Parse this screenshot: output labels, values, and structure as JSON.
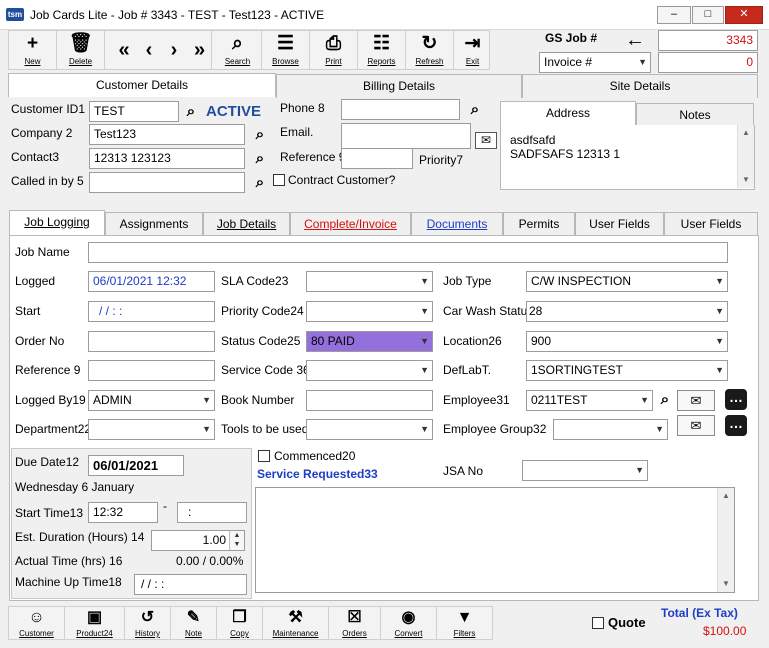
{
  "window": {
    "logo": "tsm",
    "title": "Job Cards Lite - Job # 3343 - TEST - Test123 - ACTIVE"
  },
  "toolbar": {
    "new": "New",
    "delete": "Delete",
    "search": "Search",
    "browse": "Browse",
    "print": "Print",
    "reports": "Reports",
    "refresh": "Refresh",
    "exit": "Exit"
  },
  "gsjob": {
    "label": "GS Job  #",
    "job_number": "3343",
    "mode": "Invoice #",
    "invoice_number": "0"
  },
  "top_tabs": {
    "customer": "Customer Details",
    "billing": "Billing Details",
    "site": "Site Details"
  },
  "customer": {
    "id_label": "Customer ID1",
    "id_value": "TEST",
    "status": "ACTIVE",
    "company_label": "Company 2",
    "company_value": "Test123",
    "contact_label": "Contact3",
    "contact_value": "12313 123123",
    "calledin_label": "Called in by 5",
    "calledin_value": "",
    "phone_label": "Phone 8",
    "email_label": "Email.",
    "ref_label": "Reference 9",
    "priority_label": "Priority7",
    "contract_label": "Contract Customer?"
  },
  "address": {
    "tab_address": "Address",
    "tab_notes": "Notes",
    "line1": "asdfsafd",
    "line2": "SADFSAFS  12313  1"
  },
  "job_tabs": [
    "Job Logging",
    "Assignments",
    "Job Details",
    "Complete/Invoice",
    "Documents",
    "Permits",
    "User Fields",
    "User Fields"
  ],
  "job": {
    "name_label": "Job Name",
    "name_value": "",
    "logged_label": "Logged",
    "logged_value": "06/01/2021 12:32",
    "start_label": "Start",
    "start_value": "/ /      : :",
    "order_label": "Order No",
    "ref_label": "Reference 9",
    "loggedby_label": "Logged By19",
    "loggedby_value": "ADMIN",
    "dept_label": "Department22",
    "sla_label": "SLA Code23",
    "priority_label": "Priority Code24",
    "status_label": "Status Code25",
    "status_value": "80 PAID",
    "service_label": "Service Code 36",
    "book_label": "Book Number",
    "tools_label": "Tools to be used",
    "jobtype_label": "Job Type",
    "jobtype_value": "C/W INSPECTION",
    "carwash_label": "Car Wash Status28",
    "carwash_value": "28",
    "location_label": "Location26",
    "location_value": "900",
    "deflab_label": "DefLabT.",
    "deflab_value": "1SORTINGTEST",
    "employee_label": "Employee31",
    "employee_value": "0211TEST",
    "empgroup_label": "Employee Group32"
  },
  "schedule": {
    "due_label": "Due Date12",
    "due_value": "06/01/2021",
    "day_text": "Wednesday 6 January",
    "starttime_label": "Start Time13",
    "starttime_value": "12:32",
    "dash": "-",
    "endtime_value": ":",
    "duration_label": "Est. Duration (Hours) 14",
    "duration_value": "1.00",
    "actual_label": "Actual Time (hrs) 16",
    "actual_value": "0.00 / 0.00%",
    "machine_label": "Machine Up Time18",
    "machine_value": "/ /      : :"
  },
  "service": {
    "commenced_label": "Commenced20",
    "requested_label": "Service Requested33",
    "jsa_label": "JSA No"
  },
  "bottom": {
    "customer": "Customer",
    "product": "Product24",
    "history": "History",
    "note": "Note",
    "copy": "Copy",
    "maintenance": "Maintenance",
    "orders": "Orders",
    "convert": "Convert",
    "filters": "Filters",
    "quote_label": "Quote",
    "total_label": "Total (Ex Tax)",
    "total_value": "$100.00"
  },
  "colors": {
    "status_bg": "#9370db",
    "active_blue": "#1f4f9b",
    "red": "#d41111",
    "blue_text": "#1e3cc8"
  }
}
